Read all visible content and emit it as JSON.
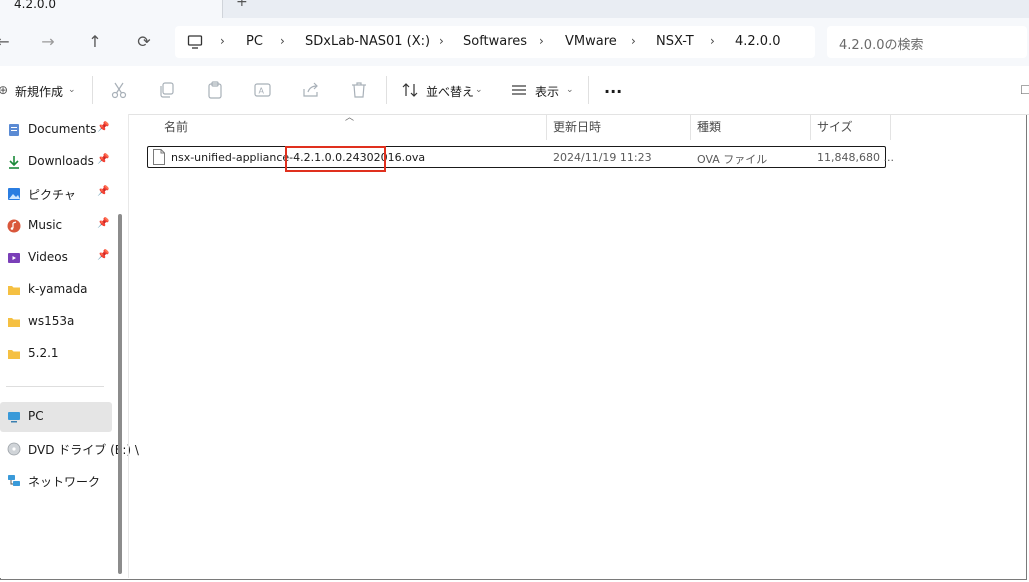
{
  "tab": {
    "title": "4.2.0.0",
    "new_tab": "+"
  },
  "nav": {
    "back": "←",
    "forward": "→",
    "up": "↑",
    "refresh": "⟳"
  },
  "breadcrumb": [
    "PC",
    "SDxLab-NAS01 (X:)",
    "Softwares",
    "VMware",
    "NSX-T",
    "4.2.0.0"
  ],
  "search": {
    "placeholder": "4.2.0.0の検索"
  },
  "toolbar": {
    "new_label": "新規作成",
    "sort_label": "並べ替え",
    "view_label": "表示",
    "more_label": "..."
  },
  "sidebar": {
    "quick": [
      {
        "label": "Documents",
        "icon": "documents-icon",
        "pinned": true
      },
      {
        "label": "Downloads",
        "icon": "downloads-icon",
        "pinned": true
      },
      {
        "label": "ピクチャ",
        "icon": "pictures-icon",
        "pinned": true
      },
      {
        "label": "Music",
        "icon": "music-icon",
        "pinned": true
      },
      {
        "label": "Videos",
        "icon": "videos-icon",
        "pinned": true
      },
      {
        "label": "k-yamada",
        "icon": "folder-icon",
        "pinned": false
      },
      {
        "label": "ws153a",
        "icon": "folder-icon",
        "pinned": false
      },
      {
        "label": "5.2.1",
        "icon": "folder-icon",
        "pinned": false
      }
    ],
    "pc": "PC",
    "dvd": "DVD ドライブ (E:) \\",
    "network": "ネットワーク",
    "pin_glyph": "📌"
  },
  "columns": {
    "name": "名前",
    "date": "更新日時",
    "type": "種類",
    "size": "サイズ"
  },
  "files": [
    {
      "name": "nsx-unified-appliance-4.2.1.0.0.24302016.ova",
      "date": "2024/11/19 11:23",
      "type": "OVA ファイル",
      "size": "11,848,680 ..."
    }
  ],
  "colors": {
    "highlight": "#e0301e",
    "folder": "#f5c042",
    "accent": "#0067c0"
  }
}
